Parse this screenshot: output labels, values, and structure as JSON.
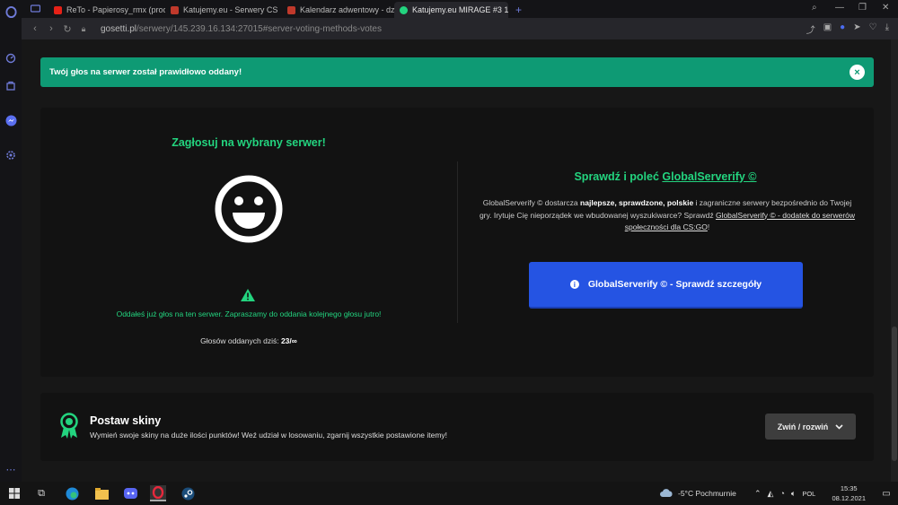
{
  "browser": {
    "tabs": [
      {
        "label": "ReTo - Papierosy_rmx (proc",
        "favicon_color": "#e62117"
      },
      {
        "label": "Katujemy.eu - Serwery CS",
        "favicon_color": "#c0392b"
      },
      {
        "label": "Kalendarz adwentowy - dz",
        "favicon_color": "#c0392b"
      },
      {
        "label": "Katujemy.eu MIRAGE #3 1.",
        "favicon_color": "#23d47f"
      }
    ],
    "new_tab": "+",
    "url_domain": "gosetti.pl",
    "url_path": "/serwery/145.239.16.134:27015#server-voting-methods-votes"
  },
  "alert": {
    "message": "Twój głos na serwer został prawidłowo oddany!",
    "close_icon": "×"
  },
  "vote": {
    "title": "Zagłosuj na wybrany serwer!",
    "already_voted": "Oddałeś już głos na ten serwer. Zapraszamy do oddania kolejnego głosu jutro!",
    "votes_label": "Głosów oddanych dziś:",
    "votes_value": "23/∞"
  },
  "serverify": {
    "title_prefix": "Sprawdź i poleć",
    "title_link": "GlobalServerify ©",
    "desc_1": "GlobalServerify © dostarcza",
    "desc_bold": "najlepsze, sprawdzone, polskie",
    "desc_2": "i zagraniczne serwery bezpośrednio do Twojej gry. Irytuje Cię nieporządek we wbudowanej wyszukiwarce? Sprawdź",
    "desc_link": "GlobalServerify © - dodatek do serwerów społeczności dla CS:GO",
    "desc_end": "!",
    "button_label": "GlobalServerify © - Sprawdź szczegóły",
    "button_icon": "i"
  },
  "skins": {
    "title": "Postaw skiny",
    "description": "Wymień swoje skiny na duże ilości punktów! Weź udział w losowaniu, zgarnij wszystkie postawione itemy!",
    "toggle_label": "Zwiń / rozwiń"
  },
  "taskbar": {
    "weather": "-5°C  Pochmurnie",
    "language": "POL",
    "time": "15:35",
    "date": "08.12.2021"
  },
  "colors": {
    "accent_green": "#23d47f",
    "alert_green": "#0e9a74",
    "button_blue": "#2554e3"
  }
}
